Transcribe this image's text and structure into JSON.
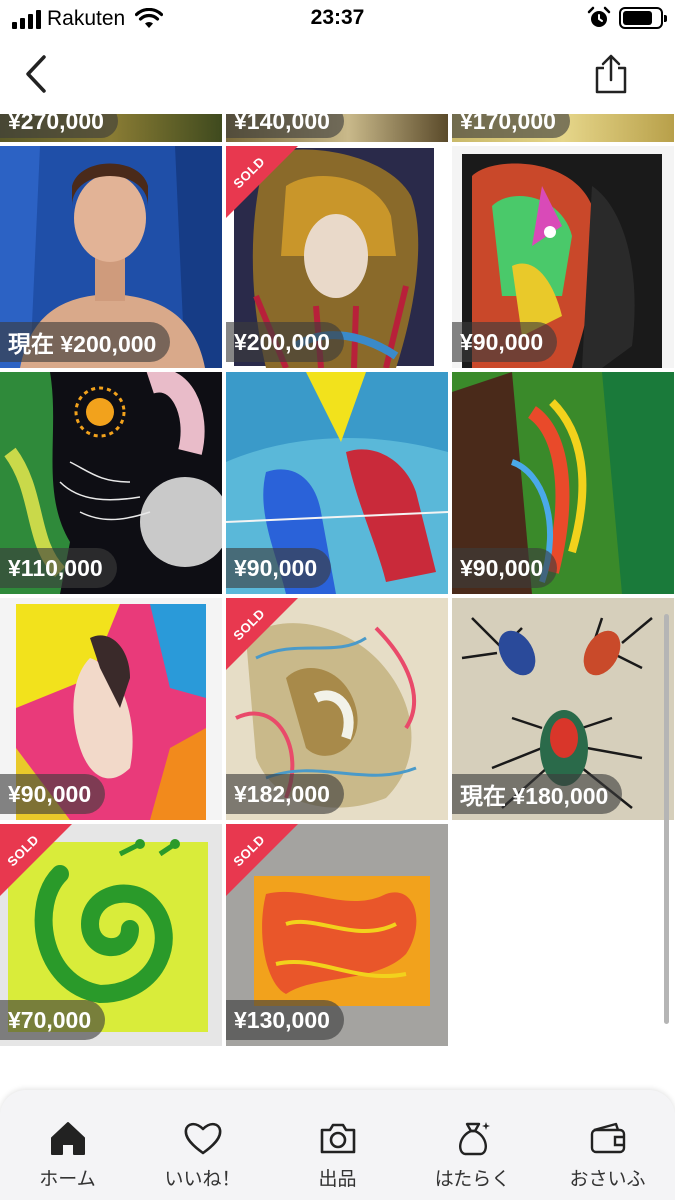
{
  "status_bar": {
    "carrier": "Rakuten",
    "time": "23:37"
  },
  "nav": {
    "back_icon": "chevron-left-icon",
    "share_icon": "share-icon"
  },
  "colors": {
    "sold_ribbon": "#e8384f",
    "price_pill": "rgba(60,60,60,0.62)",
    "tab_bar": "#f4f4f6"
  },
  "sold_label": "SOLD",
  "listings": [
    {
      "price": "¥270,000",
      "sold": false
    },
    {
      "price": "¥140,000",
      "sold": false
    },
    {
      "price": "¥170,000",
      "sold": false
    },
    {
      "price": "現在 ¥200,000",
      "sold": false
    },
    {
      "price": "¥200,000",
      "sold": true
    },
    {
      "price": "¥90,000",
      "sold": false
    },
    {
      "price": "¥110,000",
      "sold": false
    },
    {
      "price": "¥90,000",
      "sold": false
    },
    {
      "price": "¥90,000",
      "sold": false
    },
    {
      "price": "¥90,000",
      "sold": false
    },
    {
      "price": "¥182,000",
      "sold": true
    },
    {
      "price": "現在 ¥180,000",
      "sold": false
    },
    {
      "price": "¥70,000",
      "sold": true
    },
    {
      "price": "¥130,000",
      "sold": true
    }
  ],
  "tabs": [
    {
      "label": "ホーム",
      "icon": "home-icon"
    },
    {
      "label": "いいね！",
      "icon": "heart-icon"
    },
    {
      "label": "出品",
      "icon": "camera-icon"
    },
    {
      "label": "はたらく",
      "icon": "money-bag-icon"
    },
    {
      "label": "おさいふ",
      "icon": "wallet-icon"
    }
  ]
}
